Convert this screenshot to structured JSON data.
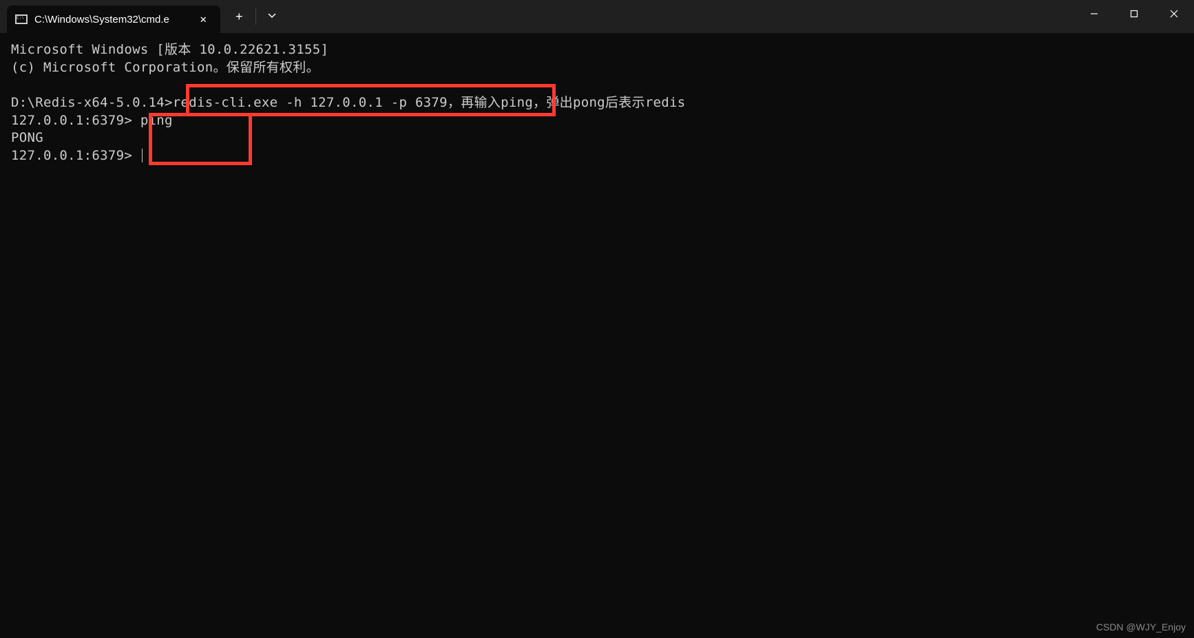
{
  "titlebar": {
    "tab_title": "C:\\Windows\\System32\\cmd.e",
    "close_symbol": "✕",
    "new_tab": "+",
    "dropdown": "⌄"
  },
  "window_controls": {
    "minimize": "—",
    "maximize": "▢",
    "close": "✕"
  },
  "terminal": {
    "line1": "Microsoft Windows [版本 10.0.22621.3155]",
    "line2": "(c) Microsoft Corporation。保留所有权利。",
    "line3": "",
    "line4": "D:\\Redis-x64-5.0.14>redis-cli.exe -h 127.0.0.1 -p 6379，再输入ping，弹出pong后表示redis",
    "line5": "127.0.0.1:6379> ping",
    "line6": "PONG",
    "line7": "127.0.0.1:6379> "
  },
  "watermark": "CSDN @WJY_Enjoy"
}
